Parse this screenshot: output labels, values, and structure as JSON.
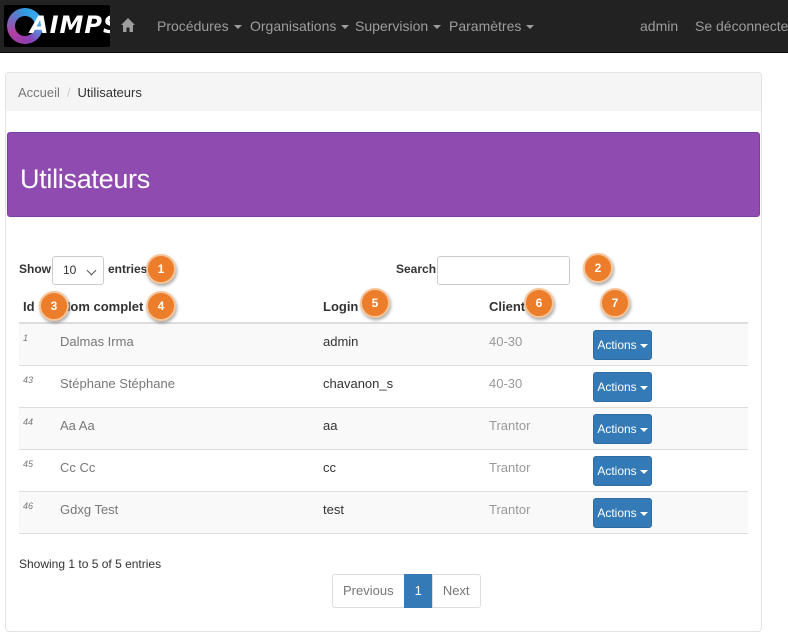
{
  "navbar": {
    "logo_text": "AIMPS",
    "home_icon": "home-icon",
    "menus": [
      {
        "label": "Procédures"
      },
      {
        "label": "Organisations"
      },
      {
        "label": "Supervision"
      },
      {
        "label": "Paramètres"
      }
    ],
    "user": "admin",
    "logout": "Se déconnecter"
  },
  "breadcrumb": {
    "home": "Accueil",
    "separator": "/",
    "current": "Utilisateurs"
  },
  "page": {
    "title": "Utilisateurs",
    "banner_color": "#8f4bb0"
  },
  "controls": {
    "show_label": "Show",
    "length_value": "10",
    "entries_label": "entries",
    "search_label": "Search:",
    "search_value": ""
  },
  "table": {
    "headers": {
      "id": "Id",
      "name": "Nom complet",
      "login": "Login",
      "client": "Client"
    },
    "rows": [
      {
        "id": "1",
        "name": "Dalmas Irma",
        "login": "admin",
        "client": "40-30",
        "action": "Actions"
      },
      {
        "id": "43",
        "name": "Stéphane Stéphane",
        "login": "chavanon_s",
        "client": "40-30",
        "action": "Actions"
      },
      {
        "id": "44",
        "name": "Aa Aa",
        "login": "aa",
        "client": "Trantor",
        "action": "Actions"
      },
      {
        "id": "45",
        "name": "Cc Cc",
        "login": "cc",
        "client": "Trantor",
        "action": "Actions"
      },
      {
        "id": "46",
        "name": "Gdxg Test",
        "login": "test",
        "client": "Trantor",
        "action": "Actions"
      }
    ]
  },
  "footer": {
    "info": "Showing 1 to 5 of 5 entries",
    "pagination": {
      "previous": "Previous",
      "current": "1",
      "next": "Next"
    }
  },
  "markers": [
    "1",
    "2",
    "3",
    "4",
    "5",
    "6",
    "7"
  ],
  "colors": {
    "accent": "#337ab7",
    "marker": "#ec7d2b",
    "navbar": "#222222"
  }
}
